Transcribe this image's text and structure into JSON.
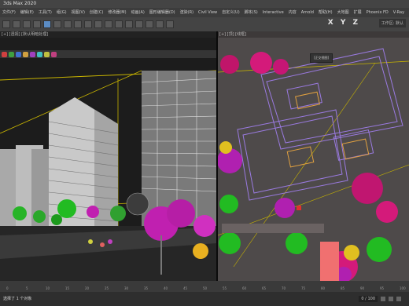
{
  "app": {
    "title": "3ds Max 2020"
  },
  "menu": [
    "文件(F)",
    "编辑(E)",
    "工具(T)",
    "组(G)",
    "视图(V)",
    "创建(C)",
    "修改器(M)",
    "动画(A)",
    "图形编辑器(D)",
    "渲染(R)",
    "Civil View",
    "自定义(U)",
    "脚本(S)",
    "Interactive",
    "内容",
    "Arnold",
    "帮助(H)",
    "大地图",
    "扩展",
    "Phoenix FD",
    "V-Ray",
    "窗口",
    "偏好设置"
  ],
  "toolbar": {
    "axis_label": "X Y Z",
    "workspace": "工作区: 默认"
  },
  "left_viewport": {
    "label": "[+] [透视] [默认明暗处理]"
  },
  "right_viewport": {
    "label": "[+] [顶] [线框]",
    "popup": "[正交视图]"
  },
  "timeline": {
    "ticks": [
      "0",
      "5",
      "10",
      "15",
      "20",
      "25",
      "30",
      "35",
      "40",
      "45",
      "50",
      "55",
      "60",
      "65",
      "70",
      "75",
      "80",
      "85",
      "90",
      "95",
      "100"
    ]
  },
  "status": {
    "text": "选择了 1 个对象",
    "frame": "0 / 100"
  },
  "colors": {
    "building": "#bfbfbf",
    "tree_magenta": "#c020b0",
    "tree_green": "#22bb22",
    "wire_purple": "#9a7ae0",
    "orange_box": "#f07070"
  }
}
